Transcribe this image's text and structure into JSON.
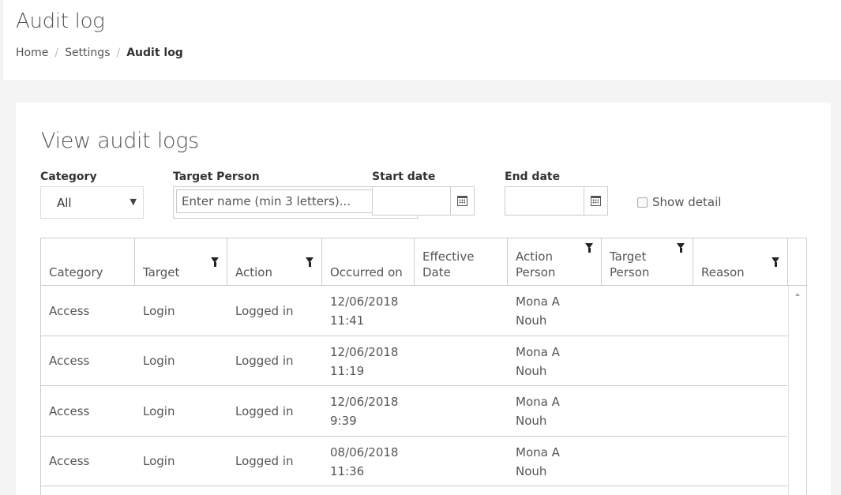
{
  "header": {
    "title": "Audit log",
    "breadcrumb": {
      "home": "Home",
      "settings": "Settings",
      "current": "Audit log",
      "sep": "/"
    }
  },
  "panel": {
    "title": "View audit logs"
  },
  "filters": {
    "category": {
      "label": "Category",
      "value": "All"
    },
    "target_person": {
      "label": "Target Person",
      "placeholder": "Enter name (min 3 letters)..."
    },
    "start_date": {
      "label": "Start date",
      "value": ""
    },
    "end_date": {
      "label": "End date",
      "value": ""
    },
    "show_detail": {
      "label": "Show detail",
      "checked": false
    }
  },
  "table": {
    "columns": [
      {
        "label": "Category",
        "filter": false
      },
      {
        "label": "Target",
        "filter": true
      },
      {
        "label": "Action",
        "filter": true
      },
      {
        "label": "Occurred on",
        "filter": false
      },
      {
        "label": "Effective Date",
        "filter": false
      },
      {
        "label": "Action Person",
        "filter": true
      },
      {
        "label": "Target Person",
        "filter": true
      },
      {
        "label": "Reason",
        "filter": true
      }
    ],
    "rows": [
      {
        "category": "Access",
        "target": "Login",
        "action": "Logged in",
        "occurred_date": "12/06/2018",
        "occurred_time": "11:41",
        "effective": "",
        "action_person_1": "Mona A",
        "action_person_2": "Nouh",
        "target_person": "",
        "reason": ""
      },
      {
        "category": "Access",
        "target": "Login",
        "action": "Logged in",
        "occurred_date": "12/06/2018",
        "occurred_time": "11:19",
        "effective": "",
        "action_person_1": "Mona A",
        "action_person_2": "Nouh",
        "target_person": "",
        "reason": ""
      },
      {
        "category": "Access",
        "target": "Login",
        "action": "Logged in",
        "occurred_date": "12/06/2018",
        "occurred_time": "9:39",
        "effective": "",
        "action_person_1": "Mona A",
        "action_person_2": "Nouh",
        "target_person": "",
        "reason": ""
      },
      {
        "category": "Access",
        "target": "Login",
        "action": "Logged in",
        "occurred_date": "08/06/2018",
        "occurred_time": "11:36",
        "effective": "",
        "action_person_1": "Mona A",
        "action_person_2": "Nouh",
        "target_person": "",
        "reason": ""
      }
    ]
  },
  "icons": {
    "calendar": "calendar-icon",
    "filter": "filter-icon",
    "dropdown": "chevron-down-icon"
  }
}
